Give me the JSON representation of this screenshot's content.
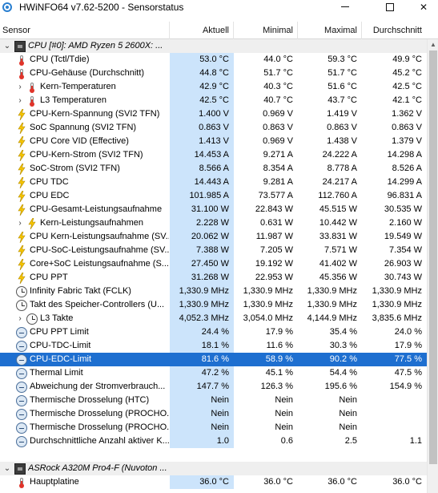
{
  "window": {
    "title": "HWiNFO64 v7.62-5200 - Sensorstatus"
  },
  "columns": {
    "sensor": "Sensor",
    "current": "Aktuell",
    "minimum": "Minimal",
    "maximum": "Maximal",
    "average": "Durchschnitt"
  },
  "rows": [
    {
      "type": "group",
      "icon": "chip-icon",
      "expander": "⌄",
      "label": "CPU [#0]: AMD Ryzen 5 2600X: ...",
      "cur": "",
      "min": "",
      "max": "",
      "avg": ""
    },
    {
      "type": "data",
      "icon": "thermometer-icon",
      "label": "CPU (Tctl/Tdie)",
      "cur": "53.0 °C",
      "min": "44.0 °C",
      "max": "59.3 °C",
      "avg": "49.9 °C"
    },
    {
      "type": "data",
      "icon": "thermometer-icon",
      "label": "CPU-Gehäuse (Durchschnitt)",
      "cur": "44.8 °C",
      "min": "51.7 °C",
      "max": "51.7 °C",
      "avg": "45.2 °C"
    },
    {
      "type": "sub",
      "icon": "thermometer-icon",
      "expander": "›",
      "label": "Kern-Temperaturen",
      "cur": "42.9 °C",
      "min": "40.3 °C",
      "max": "51.6 °C",
      "avg": "42.5 °C"
    },
    {
      "type": "sub",
      "icon": "thermometer-icon",
      "expander": "›",
      "label": "L3 Temperaturen",
      "cur": "42.5 °C",
      "min": "40.7 °C",
      "max": "43.7 °C",
      "avg": "42.1 °C"
    },
    {
      "type": "data",
      "icon": "lightning-icon",
      "label": "CPU-Kern-Spannung (SVI2 TFN)",
      "cur": "1.400 V",
      "min": "0.969 V",
      "max": "1.419 V",
      "avg": "1.362 V"
    },
    {
      "type": "data",
      "icon": "lightning-icon",
      "label": "SoC Spannung (SVI2 TFN)",
      "cur": "0.863 V",
      "min": "0.863 V",
      "max": "0.863 V",
      "avg": "0.863 V"
    },
    {
      "type": "data",
      "icon": "lightning-icon",
      "label": "CPU Core VID (Effective)",
      "cur": "1.413 V",
      "min": "0.969 V",
      "max": "1.438 V",
      "avg": "1.379 V"
    },
    {
      "type": "data",
      "icon": "lightning-icon",
      "label": "CPU-Kern-Strom (SVI2 TFN)",
      "cur": "14.453 A",
      "min": "9.271 A",
      "max": "24.222 A",
      "avg": "14.298 A"
    },
    {
      "type": "data",
      "icon": "lightning-icon",
      "label": "SoC-Strom (SVI2 TFN)",
      "cur": "8.566 A",
      "min": "8.354 A",
      "max": "8.778 A",
      "avg": "8.526 A"
    },
    {
      "type": "data",
      "icon": "lightning-icon",
      "label": "CPU TDC",
      "cur": "14.443 A",
      "min": "9.281 A",
      "max": "24.217 A",
      "avg": "14.299 A"
    },
    {
      "type": "data",
      "icon": "lightning-icon",
      "label": "CPU EDC",
      "cur": "101.985 A",
      "min": "73.577 A",
      "max": "112.760 A",
      "avg": "96.831 A"
    },
    {
      "type": "data",
      "icon": "lightning-icon",
      "label": "CPU-Gesamt-Leistungsaufnahme",
      "cur": "31.100 W",
      "min": "22.843 W",
      "max": "45.515 W",
      "avg": "30.535 W"
    },
    {
      "type": "sub",
      "icon": "lightning-icon",
      "expander": "›",
      "label": "Kern-Leistungsaufnahmen",
      "cur": "2.228 W",
      "min": "0.631 W",
      "max": "10.442 W",
      "avg": "2.160 W"
    },
    {
      "type": "data",
      "icon": "lightning-icon",
      "label": "CPU Kern-Leistungsaufnahme (SV...",
      "cur": "20.062 W",
      "min": "11.987 W",
      "max": "33.831 W",
      "avg": "19.549 W"
    },
    {
      "type": "data",
      "icon": "lightning-icon",
      "label": "CPU-SoC-Leistungsaufnahme (SV...",
      "cur": "7.388 W",
      "min": "7.205 W",
      "max": "7.571 W",
      "avg": "7.354 W"
    },
    {
      "type": "data",
      "icon": "lightning-icon",
      "label": "Core+SoC Leistungsaufnahme (S...",
      "cur": "27.450 W",
      "min": "19.192 W",
      "max": "41.402 W",
      "avg": "26.903 W"
    },
    {
      "type": "data",
      "icon": "lightning-icon",
      "label": "CPU PPT",
      "cur": "31.268 W",
      "min": "22.953 W",
      "max": "45.356 W",
      "avg": "30.743 W"
    },
    {
      "type": "data",
      "icon": "clock-icon",
      "label": "Infinity Fabric Takt (FCLK)",
      "cur": "1,330.9 MHz",
      "min": "1,330.9 MHz",
      "max": "1,330.9 MHz",
      "avg": "1,330.9 MHz"
    },
    {
      "type": "data",
      "icon": "clock-icon",
      "label": "Takt des Speicher-Controllers (U...",
      "cur": "1,330.9 MHz",
      "min": "1,330.9 MHz",
      "max": "1,330.9 MHz",
      "avg": "1,330.9 MHz"
    },
    {
      "type": "sub",
      "icon": "clock-icon",
      "expander": "›",
      "label": "L3 Takte",
      "cur": "4,052.3 MHz",
      "min": "3,054.0 MHz",
      "max": "4,144.9 MHz",
      "avg": "3,835.6 MHz"
    },
    {
      "type": "data",
      "icon": "status-circle-icon",
      "label": "CPU PPT Limit",
      "cur": "24.4 %",
      "min": "17.9 %",
      "max": "35.4 %",
      "avg": "24.0 %"
    },
    {
      "type": "data",
      "icon": "status-circle-icon",
      "label": "CPU-TDC-Limit",
      "cur": "18.1 %",
      "min": "11.6 %",
      "max": "30.3 %",
      "avg": "17.9 %"
    },
    {
      "type": "data",
      "icon": "status-circle-icon",
      "label": "CPU-EDC-Limit",
      "cur": "81.6 %",
      "min": "58.9 %",
      "max": "90.2 %",
      "avg": "77.5 %",
      "selected": true
    },
    {
      "type": "data",
      "icon": "status-circle-icon",
      "label": "Thermal Limit",
      "cur": "47.2 %",
      "min": "45.1 %",
      "max": "54.4 %",
      "avg": "47.5 %"
    },
    {
      "type": "data",
      "icon": "status-circle-icon",
      "label": "Abweichung der Stromverbrauch...",
      "cur": "147.7 %",
      "min": "126.3 %",
      "max": "195.6 %",
      "avg": "154.9 %"
    },
    {
      "type": "data",
      "icon": "status-circle-icon",
      "label": "Thermische Drosselung (HTC)",
      "cur": "Nein",
      "min": "Nein",
      "max": "Nein",
      "avg": ""
    },
    {
      "type": "data",
      "icon": "status-circle-icon",
      "label": "Thermische Drosselung (PROCHO...",
      "cur": "Nein",
      "min": "Nein",
      "max": "Nein",
      "avg": ""
    },
    {
      "type": "data",
      "icon": "status-circle-icon",
      "label": "Thermische Drosselung (PROCHO...",
      "cur": "Nein",
      "min": "Nein",
      "max": "Nein",
      "avg": ""
    },
    {
      "type": "data",
      "icon": "status-circle-icon",
      "label": "Durchschnittliche Anzahl aktiver K...",
      "cur": "1.0",
      "min": "0.6",
      "max": "2.5",
      "avg": "1.1"
    },
    {
      "type": "spacer",
      "label": "",
      "cur": "",
      "min": "",
      "max": "",
      "avg": ""
    },
    {
      "type": "group",
      "icon": "chip-icon",
      "expander": "⌄",
      "label": "ASRock A320M Pro4-F (Nuvoton ...",
      "cur": "",
      "min": "",
      "max": "",
      "avg": ""
    },
    {
      "type": "data",
      "icon": "thermometer-icon",
      "label": "Hauptplatine",
      "cur": "36.0 °C",
      "min": "36.0 °C",
      "max": "36.0 °C",
      "avg": "36.0 °C"
    }
  ]
}
